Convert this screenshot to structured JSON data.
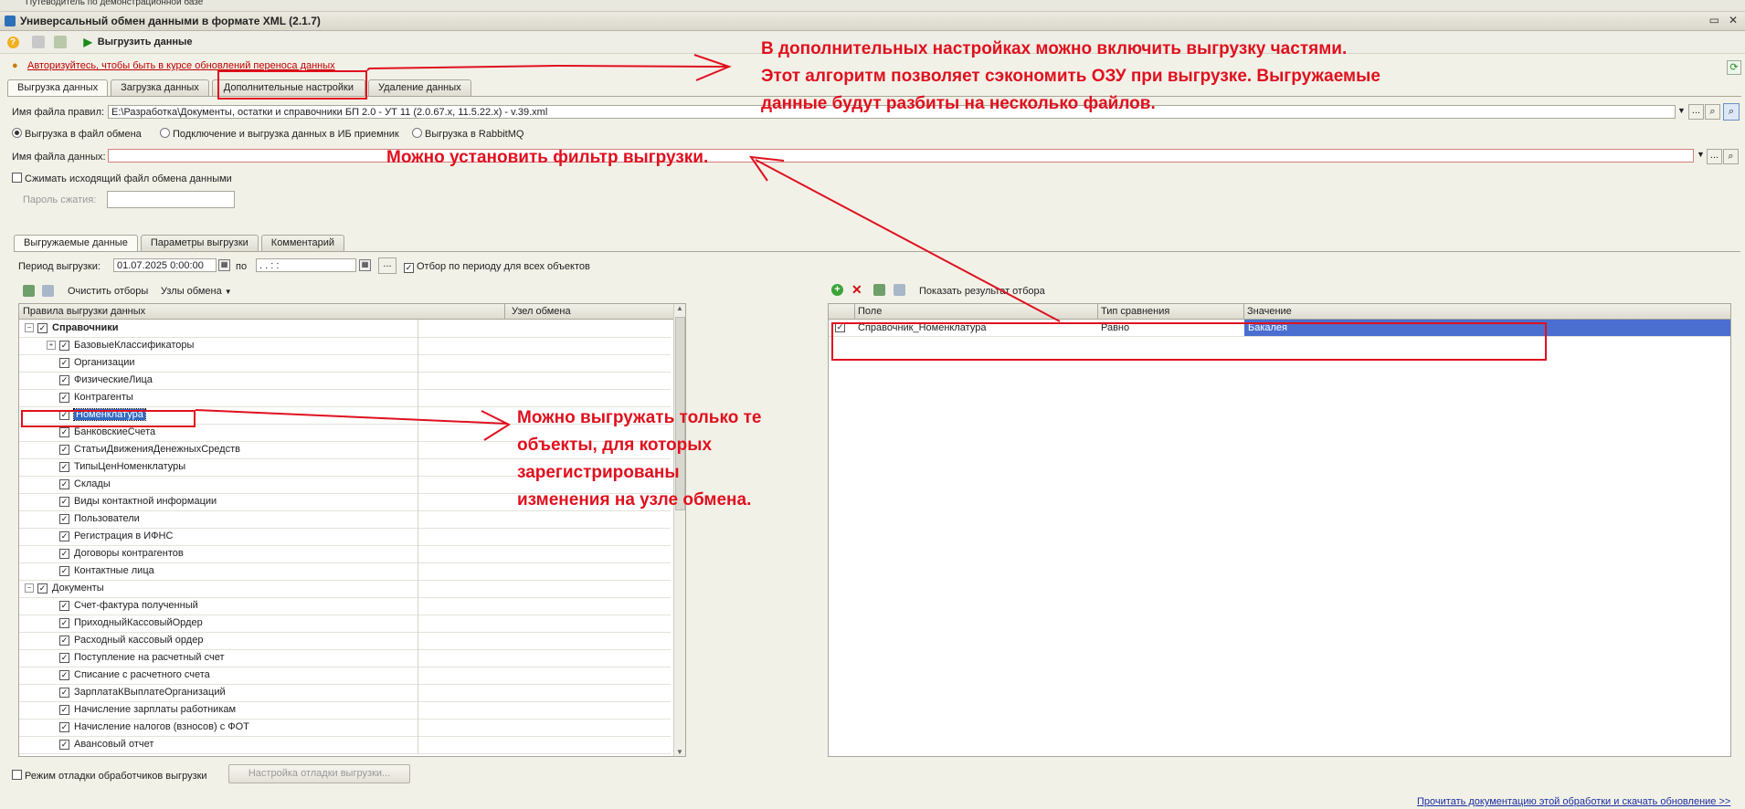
{
  "top_strip": "Путеводитель по демонстрационной базе",
  "window": {
    "title": "Универсальный обмен данными в формате XML (2.1.7)"
  },
  "toolbar": {
    "export_button": "Выгрузить данные"
  },
  "auth_link": "Авторизуйтесь, чтобы быть в курсе обновлений переноса данных",
  "main_tabs": [
    "Выгрузка данных",
    "Загрузка данных",
    "Дополнительные настройки",
    "Удаление данных"
  ],
  "rules_file": {
    "label": "Имя файла правил:",
    "value": "E:\\Разработка\\Документы, остатки и справочники БП 2.0 - УТ 11 (2.0.67.х, 11.5.22.х) - v.39.xml"
  },
  "export_modes": [
    "Выгрузка в файл обмена",
    "Подключение и выгрузка данных в ИБ приемник",
    "Выгрузка в RabbitMQ"
  ],
  "data_file": {
    "label": "Имя файла данных:",
    "value": ""
  },
  "compress": {
    "label": "Сжимать исходящий файл обмена данными"
  },
  "password": {
    "label": "Пароль сжатия:"
  },
  "sub_tabs": [
    "Выгружаемые данные",
    "Параметры выгрузки",
    "Комментарий"
  ],
  "period": {
    "label": "Период выгрузки:",
    "from": "01.07.2025  0:00:00",
    "to_label": "по",
    "to": " .  .      :  :",
    "filter_all": "Отбор по периоду для всех объектов"
  },
  "left_toolbar": {
    "clear_filters": "Очистить отборы",
    "nodes": "Узлы обмена"
  },
  "left_grid": {
    "columns": [
      "Правила выгрузки данных",
      "Узел обмена"
    ],
    "rows": [
      {
        "text": "Справочники",
        "level": 0,
        "group": true
      },
      {
        "text": "БазовыеКлассификаторы",
        "level": 1,
        "expand": true
      },
      {
        "text": "Организации",
        "level": 1
      },
      {
        "text": "ФизическиеЛица",
        "level": 1
      },
      {
        "text": "Контрагенты",
        "level": 1
      },
      {
        "text": "Номенклатура",
        "level": 1,
        "selected": true
      },
      {
        "text": "БанковскиеСчета",
        "level": 1
      },
      {
        "text": "СтатьиДвиженияДенежныхСредств",
        "level": 1
      },
      {
        "text": "ТипыЦенНоменклатуры",
        "level": 1
      },
      {
        "text": "Склады",
        "level": 1
      },
      {
        "text": "Виды контактной информации",
        "level": 1
      },
      {
        "text": "Пользователи",
        "level": 1
      },
      {
        "text": "Регистрация в ИФНС",
        "level": 1
      },
      {
        "text": "Договоры контрагентов",
        "level": 1
      },
      {
        "text": "Контактные лица",
        "level": 1
      },
      {
        "text": "Документы",
        "level": 0,
        "group": true
      },
      {
        "text": "Счет-фактура полученный",
        "level": 1
      },
      {
        "text": "ПриходныйКассовыйОрдер",
        "level": 1
      },
      {
        "text": "Расходный кассовый ордер",
        "level": 1
      },
      {
        "text": "Поступление на расчетный счет",
        "level": 1
      },
      {
        "text": "Списание с расчетного счета",
        "level": 1
      },
      {
        "text": "ЗарплатаКВыплатеОрганизаций",
        "level": 1
      },
      {
        "text": "Начисление зарплаты работникам",
        "level": 1
      },
      {
        "text": "Начисление налогов (взносов) с ФОТ",
        "level": 1
      },
      {
        "text": "Авансовый отчет",
        "level": 1
      }
    ]
  },
  "right_toolbar": {
    "show_result": "Показать результат отбора"
  },
  "right_grid": {
    "columns": [
      "Поле",
      "Тип сравнения",
      "Значение"
    ],
    "rows": [
      {
        "field": "Справочник_Номенклатура",
        "compare": "Равно",
        "value": "Бакалея"
      }
    ]
  },
  "debug": {
    "checkbox": "Режим отладки обработчиков выгрузки",
    "button": "Настройка отладки выгрузки..."
  },
  "doc_link": "Прочитать документацию этой обработки и скачать обновление >>",
  "annotations": {
    "settings": [
      "В дополнительных настройках можно включить выгрузку частями.",
      "Этот алгоритм позволяет сэкономить ОЗУ при выгрузке. Выгружаемые",
      "данные будут разбиты на несколько файлов."
    ],
    "filter": "Можно установить фильтр выгрузки.",
    "nodes": [
      "Можно выгружать только те",
      "объекты, для которых",
      "зарегистрированы",
      "изменения на узле обмена."
    ]
  }
}
